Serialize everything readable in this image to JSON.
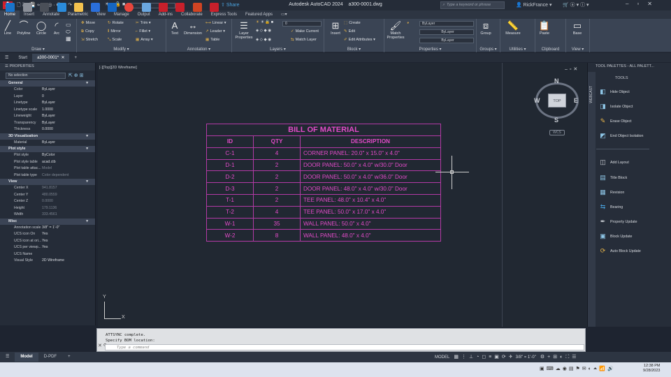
{
  "app": {
    "logo_text": "A",
    "title": "Autodesk AutoCAD 2024",
    "file": "a300-0001.dwg",
    "search_placeholder": "Type a keyword or phrase",
    "user": "RickFrance",
    "share": "Share",
    "layer_current": "0"
  },
  "ribbon_tabs": [
    "Home",
    "Insert",
    "Annotate",
    "Parametric",
    "View",
    "Manage",
    "Output",
    "Add-ins",
    "Collaborate",
    "Express Tools",
    "Featured Apps"
  ],
  "ribbon": {
    "draw": {
      "label": "Draw",
      "line": "Line",
      "polyline": "Polyline",
      "circle": "Circle",
      "arc": "Arc"
    },
    "modify": {
      "label": "Modify",
      "move": "Move",
      "rotate": "Rotate",
      "trim": "Trim",
      "copy": "Copy",
      "mirror": "Mirror",
      "fillet": "Fillet",
      "stretch": "Stretch",
      "scale": "Scale",
      "array": "Array"
    },
    "annotation": {
      "label": "Annotation",
      "text": "Text",
      "dimension": "Dimension",
      "linear": "Linear",
      "leader": "Leader",
      "table": "Table"
    },
    "layers": {
      "label": "Layers",
      "layer_properties": "Layer Properties",
      "make_current": "Make Current",
      "match_layer": "Match Layer",
      "layer_value": "0"
    },
    "block": {
      "label": "Block",
      "insert": "Insert",
      "create": "Create",
      "edit": "Edit",
      "edit_attributes": "Edit Attributes"
    },
    "properties": {
      "label": "Properties",
      "match_properties": "Match Properties",
      "color": "ByLayer",
      "lineweight": "ByLayer",
      "linetype": "ByLayer"
    },
    "groups": {
      "label": "Groups",
      "group": "Group"
    },
    "utilities": {
      "label": "Utilities",
      "measure": "Measure"
    },
    "clipboard": {
      "label": "Clipboard",
      "paste": "Paste"
    },
    "view": {
      "label": "View",
      "base": "Base"
    }
  },
  "doc_tabs": {
    "start": "Start",
    "active": "a300-0001*"
  },
  "properties": {
    "header": "PROPERTIES",
    "selection": "No selection",
    "sections": [
      {
        "title": "General",
        "rows": [
          [
            "Color",
            "ByLayer"
          ],
          [
            "Layer",
            "0"
          ],
          [
            "Linetype",
            "ByLayer"
          ],
          [
            "Linetype scale",
            "1.0000"
          ],
          [
            "Lineweight",
            "ByLayer"
          ],
          [
            "Transparency",
            "ByLayer"
          ],
          [
            "Thickness",
            "0.0000"
          ]
        ]
      },
      {
        "title": "3D Visualization",
        "rows": [
          [
            "Material",
            "ByLayer"
          ]
        ]
      },
      {
        "title": "Plot style",
        "rows": [
          [
            "Plot style",
            "ByColor"
          ],
          [
            "Plot style table",
            "acad.ctb"
          ],
          [
            "Plot table attac...",
            "Model"
          ],
          [
            "Plot table type",
            "Color dependent"
          ]
        ]
      },
      {
        "title": "View",
        "rows": [
          [
            "Center X",
            "941.8157"
          ],
          [
            "Center Y",
            "480.0559"
          ],
          [
            "Center Z",
            "0.0000"
          ],
          [
            "Height",
            "179.1136"
          ],
          [
            "Width",
            "333.4561"
          ]
        ]
      },
      {
        "title": "Misc",
        "rows": [
          [
            "Annotation scale",
            "3/8\" = 1'-0\""
          ],
          [
            "UCS icon On",
            "Yes"
          ],
          [
            "UCS icon at ori...",
            "Yes"
          ],
          [
            "UCS per viewp...",
            "Yes"
          ],
          [
            "UCS Name",
            ""
          ],
          [
            "Visual Style",
            "2D Wireframe"
          ]
        ]
      }
    ]
  },
  "viewport": {
    "label": "[-][Top][2D Wireframe]",
    "cube_top": "TOP",
    "n": "N",
    "s": "S",
    "e": "E",
    "w": "W",
    "wcs": "WCS",
    "ucs_x": "X",
    "ucs_y": "Y"
  },
  "bom": {
    "title": "BILL OF MATERIAL",
    "headers": [
      "ID",
      "QTY",
      "DESCRIPTION"
    ],
    "rows": [
      [
        "C-1",
        "4",
        "CORNER PANEL: 20.0\" x 15.0\" x 4.0\""
      ],
      [
        "D-1",
        "2",
        "DOOR PANEL: 50.0\" x 4.0\" w/30.0\" Door"
      ],
      [
        "D-2",
        "2",
        "DOOR PANEL: 50.0\" x 4.0\" w/36.0\" Door"
      ],
      [
        "D-3",
        "2",
        "DOOR PANEL: 48.0\" x 4.0\" w/30.0\" Door"
      ],
      [
        "T-1",
        "2",
        "TEE PANEL: 48.0\" x 10.4\" x 4.0\""
      ],
      [
        "T-2",
        "4",
        "TEE PANEL: 50.0\" x 17.0\" x 4.0\""
      ],
      [
        "W-1",
        "35",
        "WALL PANEL: 50.0\" x 4.0\""
      ],
      [
        "W-2",
        "8",
        "WALL PANEL: 48.0\" x 4.0\""
      ]
    ]
  },
  "tool_palette": {
    "header": "TOOL PALETTES - ALL PALETT...",
    "section": "TOOLS",
    "strip": "WEBCAST",
    "items": [
      "Hide Object",
      "Isolate Object",
      "Erase Object",
      "End Object Isolation",
      "Add Layout",
      "Title Block",
      "Revision",
      "Bearing",
      "Property Update",
      "Block Update",
      "Auto Block Update"
    ]
  },
  "command": {
    "line1": "ATTSYNC complete.",
    "line2": "Specify BOM location:",
    "placeholder": "Type a command"
  },
  "layout_tabs": [
    "Model",
    "D-PDF"
  ],
  "status": {
    "model": "MODEL",
    "scale": "3/8\" = 1'-0\""
  },
  "clock": {
    "time": "12:38 PM",
    "date": "9/28/2023"
  }
}
